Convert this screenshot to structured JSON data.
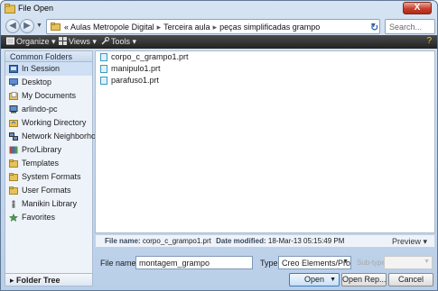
{
  "window": {
    "title": "File Open",
    "close_glyph": "X"
  },
  "address": {
    "back_glyph": "◀",
    "forward_glyph": "▶",
    "prefix": "«",
    "path": [
      "Aulas Metropole Digital",
      "Terceira aula",
      "peças simplificadas grampo"
    ],
    "search_placeholder": "Search..."
  },
  "toolbar": {
    "organize": "Organize ▾",
    "views": "Views ▾",
    "tools": "Tools ▾"
  },
  "sidebar": {
    "header": "Common Folders",
    "items": [
      {
        "label": "In Session",
        "icon": "session-icon"
      },
      {
        "label": "Desktop",
        "icon": "desktop-icon"
      },
      {
        "label": "My Documents",
        "icon": "documents-folder-icon"
      },
      {
        "label": "arlindo-pc",
        "icon": "computer-icon"
      },
      {
        "label": "Working Directory",
        "icon": "working-directory-icon"
      },
      {
        "label": "Network Neighborhood",
        "icon": "network-icon"
      },
      {
        "label": "Pro/Library",
        "icon": "library-icon"
      },
      {
        "label": "Templates",
        "icon": "folder-icon"
      },
      {
        "label": "System Formats",
        "icon": "folder-icon"
      },
      {
        "label": "User Formats",
        "icon": "folder-icon"
      },
      {
        "label": "Manikin Library",
        "icon": "manikin-icon"
      },
      {
        "label": "Favorites",
        "icon": "favorites-icon"
      }
    ],
    "footer": "▸ Folder Tree"
  },
  "files": [
    {
      "name": "corpo_c_grampo1.prt",
      "icon": "part-file-icon"
    },
    {
      "name": "manipulo1.prt",
      "icon": "part-file-icon"
    },
    {
      "name": "parafuso1.prt",
      "icon": "part-file-icon"
    }
  ],
  "info": {
    "file_name_label": "File name:",
    "file_name": "corpo_c_grampo1.prt",
    "date_label": "Date modified:",
    "date": "18-Mar-13 05:15:49 PM",
    "preview": "Preview ▾"
  },
  "form": {
    "file_name_label": "File name",
    "file_name_value": "montagem_grampo",
    "type_label": "Type",
    "type_value": "Creo Elements/Pro",
    "subtype_label": "Sub-type",
    "open_button": "Open",
    "open_rep_button": "Open Rep...",
    "cancel_button": "Cancel"
  },
  "colors": {
    "toolbar_bg": "#2b2b2b",
    "accent_blue": "#3d7bbf",
    "folder_yellow": "#e6c25a"
  }
}
